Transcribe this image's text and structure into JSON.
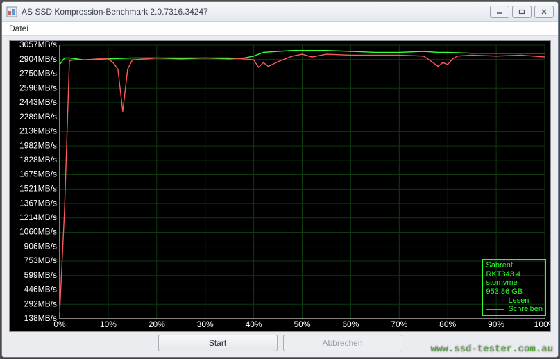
{
  "window": {
    "title": "AS SSD Kompression-Benchmark 2.0.7316.34247"
  },
  "menu": {
    "datei": "Datei"
  },
  "buttons": {
    "start": "Start",
    "abort": "Abbrechen"
  },
  "legend": {
    "device": "Sabrent",
    "model": "RKT343.4",
    "driver": "stornvme",
    "size": "953,86 GB",
    "read": "Lesen",
    "write": "Schreiben"
  },
  "watermark": "www.ssd-tester.com.au",
  "colors": {
    "read": "#35ff35",
    "write": "#ff5a5a",
    "grid": "#0e3a0e",
    "axis": "#ffffff",
    "bg": "#000000"
  },
  "chart_data": {
    "type": "line",
    "xlabel": "",
    "ylabel": "",
    "xlim": [
      0,
      100
    ],
    "ylim": [
      138,
      3057
    ],
    "x_ticks": [
      0,
      10,
      20,
      30,
      40,
      50,
      60,
      70,
      80,
      90,
      100
    ],
    "y_ticks": [
      3057,
      2904,
      2750,
      2596,
      2443,
      2289,
      2136,
      1982,
      1828,
      1675,
      1521,
      1367,
      1214,
      1060,
      906,
      753,
      599,
      446,
      292,
      138
    ],
    "x_tick_suffix": "%",
    "y_tick_suffix": "MB/s",
    "series": [
      {
        "name": "Lesen",
        "color": "#35ff35",
        "x": [
          0,
          1,
          2,
          5,
          10,
          15,
          20,
          25,
          30,
          35,
          38,
          40,
          42,
          45,
          48,
          50,
          55,
          60,
          65,
          70,
          75,
          78,
          80,
          85,
          90,
          95,
          100
        ],
        "y": [
          2850,
          2920,
          2920,
          2900,
          2910,
          2920,
          2920,
          2910,
          2920,
          2910,
          2920,
          2940,
          2980,
          2990,
          3000,
          3000,
          3000,
          2990,
          2980,
          2980,
          2990,
          2980,
          2980,
          2970,
          2970,
          2970,
          2970
        ]
      },
      {
        "name": "Schreiben",
        "color": "#ff5a5a",
        "x": [
          0,
          1,
          2,
          3,
          5,
          8,
          10,
          11,
          12,
          13,
          14,
          15,
          18,
          20,
          25,
          30,
          35,
          38,
          40,
          41,
          42,
          43,
          45,
          48,
          50,
          52,
          55,
          60,
          65,
          70,
          75,
          77,
          78,
          79,
          80,
          81,
          82,
          85,
          90,
          95,
          100
        ],
        "y": [
          200,
          1300,
          2890,
          2900,
          2900,
          2910,
          2910,
          2870,
          2800,
          2350,
          2800,
          2900,
          2910,
          2920,
          2920,
          2920,
          2920,
          2910,
          2900,
          2820,
          2870,
          2830,
          2880,
          2940,
          2960,
          2930,
          2960,
          2950,
          2950,
          2950,
          2940,
          2870,
          2830,
          2870,
          2850,
          2910,
          2940,
          2950,
          2940,
          2950,
          2930
        ]
      }
    ]
  }
}
